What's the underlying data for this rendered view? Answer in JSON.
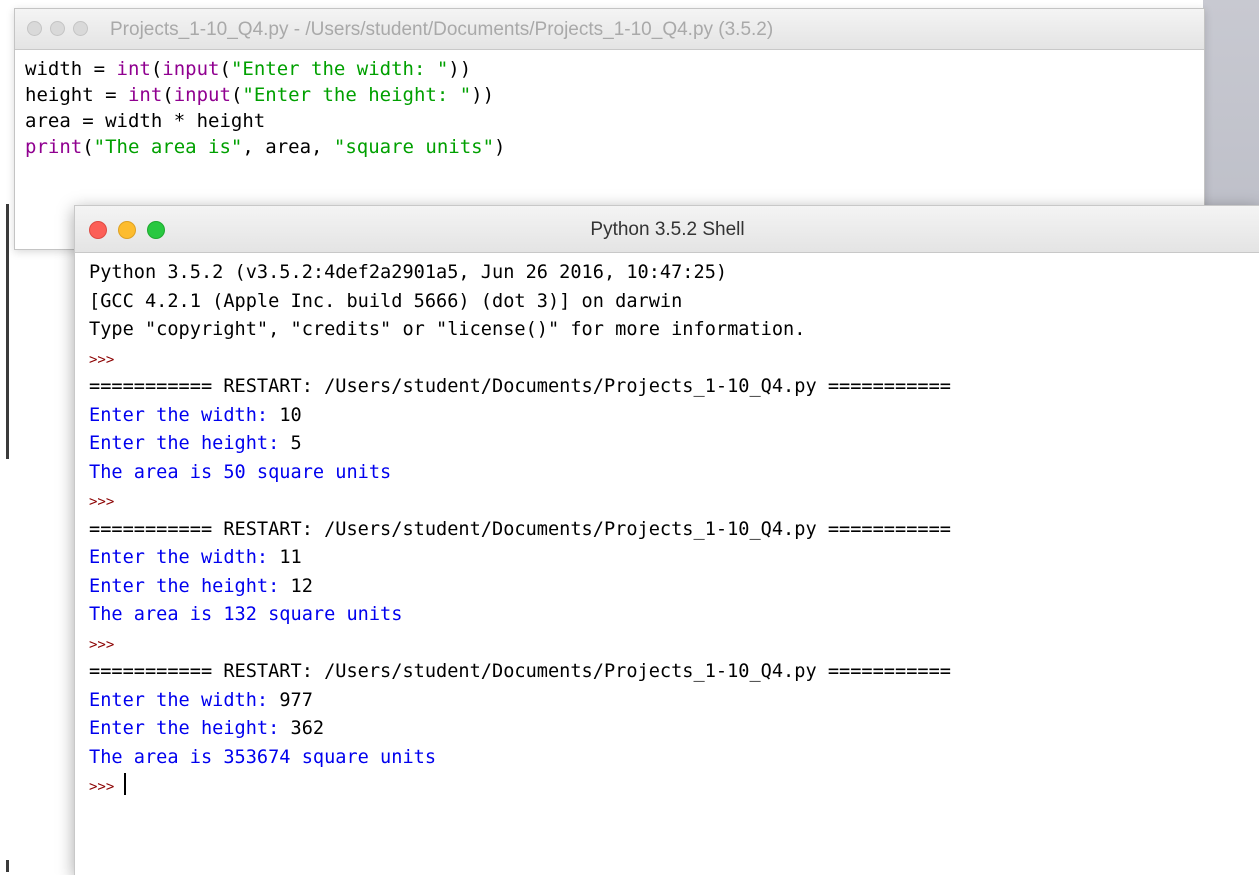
{
  "editor": {
    "title": "Projects_1-10_Q4.py - /Users/student/Documents/Projects_1-10_Q4.py (3.5.2)",
    "lines": [
      [
        {
          "t": "width = ",
          "c": "kw-black"
        },
        {
          "t": "int",
          "c": "kw-purple"
        },
        {
          "t": "(",
          "c": "kw-black"
        },
        {
          "t": "input",
          "c": "kw-purple"
        },
        {
          "t": "(",
          "c": "kw-black"
        },
        {
          "t": "\"Enter the width: \"",
          "c": "str-green"
        },
        {
          "t": "))",
          "c": "kw-black"
        }
      ],
      [
        {
          "t": "height = ",
          "c": "kw-black"
        },
        {
          "t": "int",
          "c": "kw-purple"
        },
        {
          "t": "(",
          "c": "kw-black"
        },
        {
          "t": "input",
          "c": "kw-purple"
        },
        {
          "t": "(",
          "c": "kw-black"
        },
        {
          "t": "\"Enter the height: \"",
          "c": "str-green"
        },
        {
          "t": "))",
          "c": "kw-black"
        }
      ],
      [
        {
          "t": "area = width * height",
          "c": "kw-black"
        }
      ],
      [
        {
          "t": "print",
          "c": "kw-purple"
        },
        {
          "t": "(",
          "c": "kw-black"
        },
        {
          "t": "\"The area is\"",
          "c": "str-green"
        },
        {
          "t": ", area, ",
          "c": "kw-black"
        },
        {
          "t": "\"square units\"",
          "c": "str-green"
        },
        {
          "t": ")",
          "c": "kw-black"
        }
      ]
    ]
  },
  "shell": {
    "title": "Python 3.5.2 Shell",
    "lines": [
      {
        "t": "Python 3.5.2 (v3.5.2:4def2a2901a5, Jun 26 2016, 10:47:25)",
        "c": "c-black"
      },
      {
        "t": "[GCC 4.2.1 (Apple Inc. build 5666) (dot 3)] on darwin",
        "c": "c-black"
      },
      {
        "t": "Type \"copyright\", \"credits\" or \"license()\" for more information.",
        "c": "c-black"
      },
      {
        "t": ">>>",
        "c": "c-prompt"
      },
      {
        "t": "=========== RESTART: /Users/student/Documents/Projects_1-10_Q4.py ===========",
        "c": "c-restart"
      },
      {
        "t": "Enter the width: ",
        "c": "c-blue",
        "v": "10"
      },
      {
        "t": "Enter the height: ",
        "c": "c-blue",
        "v": "5"
      },
      {
        "t": "The area is 50 square units",
        "c": "c-blue"
      },
      {
        "t": ">>>",
        "c": "c-prompt"
      },
      {
        "t": "=========== RESTART: /Users/student/Documents/Projects_1-10_Q4.py ===========",
        "c": "c-restart"
      },
      {
        "t": "Enter the width: ",
        "c": "c-blue",
        "v": "11"
      },
      {
        "t": "Enter the height: ",
        "c": "c-blue",
        "v": "12"
      },
      {
        "t": "The area is 132 square units",
        "c": "c-blue"
      },
      {
        "t": ">>>",
        "c": "c-prompt"
      },
      {
        "t": "=========== RESTART: /Users/student/Documents/Projects_1-10_Q4.py ===========",
        "c": "c-restart"
      },
      {
        "t": "Enter the width: ",
        "c": "c-blue",
        "v": "977"
      },
      {
        "t": "Enter the height: ",
        "c": "c-blue",
        "v": "362"
      },
      {
        "t": "The area is 353674 square units",
        "c": "c-blue"
      },
      {
        "t": ">>>",
        "c": "c-prompt",
        "cursor": true
      }
    ]
  },
  "colors": {
    "string": "#00a000",
    "builtin": "#900090",
    "output": "#0000ee",
    "prompt": "#8b0000"
  }
}
